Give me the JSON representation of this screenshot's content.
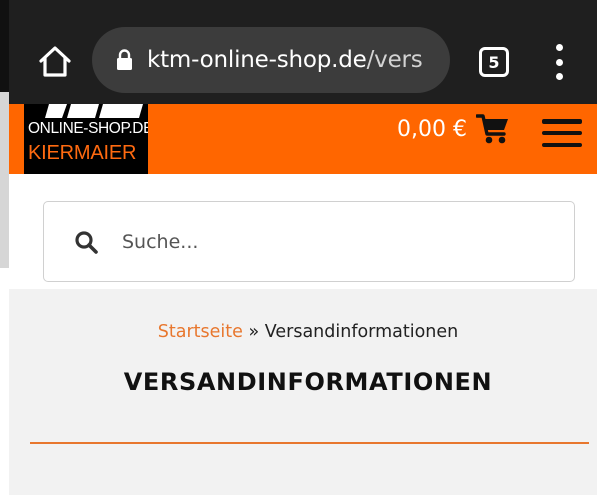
{
  "browser": {
    "url_host": "ktm-online-shop.de",
    "url_path": "/vers",
    "tab_count": "5"
  },
  "site_header": {
    "logo_line1": "ONLINE-SHOP.DE",
    "logo_line2": "KIERMAIER",
    "cart_total": "0,00 €",
    "accent_color": "#ff6600"
  },
  "search": {
    "placeholder": "Suche..."
  },
  "breadcrumb": {
    "home": "Startseite",
    "separator": "»",
    "current": "Versandinformationen"
  },
  "page": {
    "title": "VERSANDINFORMATIONEN"
  }
}
